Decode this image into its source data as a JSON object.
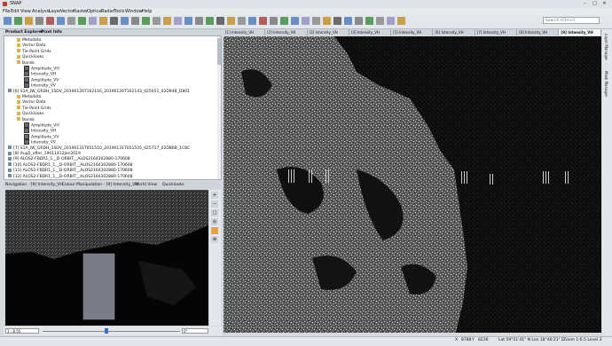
{
  "app": {
    "title": "SNAP",
    "win_min": "–",
    "win_max": "□",
    "win_close": "✕"
  },
  "menu": [
    "File",
    "Edit",
    "View",
    "Analysis",
    "Layer",
    "Vector",
    "Raster",
    "Optical",
    "Radar",
    "Tools",
    "Window",
    "Help"
  ],
  "toolbar": {
    "search_placeholder": "Search (Ctrl+I)"
  },
  "left_panel": {
    "tabs": [
      "Product Explorer",
      "Pixel Info"
    ]
  },
  "tree": [
    {
      "label": "Metadata",
      "icon": "folder"
    },
    {
      "label": "Vector Data",
      "icon": "folder"
    },
    {
      "label": "Tie-Point Grids",
      "icon": "folder"
    },
    {
      "label": "Quicklooks",
      "icon": "folder"
    },
    {
      "label": "Bands",
      "icon": "folder"
    },
    {
      "label": "Amplitude_VH",
      "icon": "band"
    },
    {
      "label": "Intensity_VH",
      "icon": "band"
    },
    {
      "label": "Amplitude_VV",
      "icon": "band"
    },
    {
      "label": "Intensity_VV",
      "icon": "band"
    },
    {
      "label": "[6] S1A_IW_GRDH_1SDV_20190126T162116_20190126T162143_025651_02D94B_D801",
      "icon": "product"
    },
    {
      "label": "Metadata",
      "icon": "folder"
    },
    {
      "label": "Vector Data",
      "icon": "folder"
    },
    {
      "label": "Tie-Point Grids",
      "icon": "folder"
    },
    {
      "label": "Quicklooks",
      "icon": "folder"
    },
    {
      "label": "Bands",
      "icon": "folder"
    },
    {
      "label": "Amplitude_VH",
      "icon": "band"
    },
    {
      "label": "Intensity_VH",
      "icon": "band"
    },
    {
      "label": "Amplitude_VV",
      "icon": "band"
    },
    {
      "label": "Intensity_VV",
      "icon": "band"
    },
    {
      "label": "[7] S1A_IW_GRDH_1SDV_20190131T051510_20190131T051535_025717_02DB6B_1C8C",
      "icon": "product"
    },
    {
      "label": "[8] Aug5_after_19011412Jan2019",
      "icon": "product"
    },
    {
      "label": "[9] ALOS2-FBDR1_1__D-ORBIT__ALOS2164302880-170608",
      "icon": "product"
    },
    {
      "label": "[10] ALOS2-FBDR1_1__D-ORBIT__ALOS2164302880-170608",
      "icon": "product"
    },
    {
      "label": "[11] ALOS2-FBDR1_1__D-ORBIT__ALOS2164302880-170608",
      "icon": "product"
    },
    {
      "label": "[12] ALOS2-FBDR1_1__D-ORBIT__ALOS2164302880-170608",
      "icon": "product"
    }
  ],
  "nav_tabs": [
    "Navigation - [9] Intensity_VH",
    "Colour Manipulation - [9] Intensity_VH",
    "World View",
    "Quicklooks"
  ],
  "nav": {
    "zoom_value": "1 : 8.55",
    "rotation_value": "0°"
  },
  "doc_tabs": [
    "[1] Intensity_VH",
    "[2] Intensity_VH",
    "[3] Intensity_VH",
    "[4] Intensity_VH",
    "[5] Intensity_VH",
    "[6] Intensity_VH",
    "[7] Intensity_VH",
    "[8] Intensity_VH",
    "[9] Intensity_VH"
  ],
  "right_tabs": [
    "Layer Manager",
    "Mask Manager"
  ],
  "status": {
    "x": "X",
    "x_val": "8788",
    "y": "Y",
    "y_val": "8236",
    "latlon": "Lat 59°51'41\" N  Lon 18°46'21\" E",
    "zoom": "Zoom 1:6.5  Level 3"
  }
}
